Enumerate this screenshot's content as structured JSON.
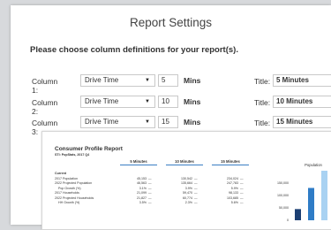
{
  "dialog": {
    "title": "Report Settings",
    "prompt": "Please choose column definitions for your report(s)."
  },
  "columns": [
    {
      "label": "Column 1:",
      "type": "Drive Time",
      "value": "5",
      "unit": "Mins",
      "title_label": "Title:",
      "title": "5 Minutes"
    },
    {
      "label": "Column 2:",
      "type": "Drive Time",
      "value": "10",
      "unit": "Mins",
      "title_label": "Title:",
      "title": "10 Minutes"
    },
    {
      "label": "Column 3:",
      "type": "Drive Time",
      "value": "15",
      "unit": "Mins",
      "title_label": "Title:",
      "title": "15 Minutes"
    }
  ],
  "icons": {
    "dropdown": "caret-down-icon"
  },
  "preview": {
    "title": "Consumer Profile Report",
    "subtitle": "STI: PopStats, 2017 Q4",
    "column_headers": [
      "5 Minutes",
      "10 Minutes",
      "15 Minutes"
    ],
    "rows": [
      {
        "label": "Current",
        "section": true,
        "values": [
          "",
          "",
          ""
        ]
      },
      {
        "label": "2017 Population",
        "values": [
          "45,153",
          "130,542",
          "234,024"
        ]
      },
      {
        "label": "2022 Projected Population",
        "values": [
          "46,563",
          "135,664",
          "247,783"
        ]
      },
      {
        "label": "Pop Growth (%)",
        "values": [
          "3.1%",
          "3.9%",
          "5.9%"
        ]
      },
      {
        "label": "2017 Households",
        "values": [
          "21,099",
          "59,470",
          "98,133"
        ]
      },
      {
        "label": "2022 Projected Households",
        "values": [
          "21,827",
          "60,774",
          "103,685"
        ]
      },
      {
        "label": "HH Growth (%)",
        "values": [
          "3.5%",
          "2.3%",
          "5.6%"
        ]
      }
    ],
    "dash": "—",
    "chart_data": {
      "type": "bar",
      "title": "Population",
      "yticks": [
        "150,000",
        "100,000",
        "50,000",
        "0"
      ],
      "ylim": [
        0,
        200000
      ],
      "values": [
        45153,
        130542,
        234024
      ],
      "colors": [
        "#1c3f73",
        "#2f7cc6",
        "#a9d2f2"
      ]
    }
  }
}
